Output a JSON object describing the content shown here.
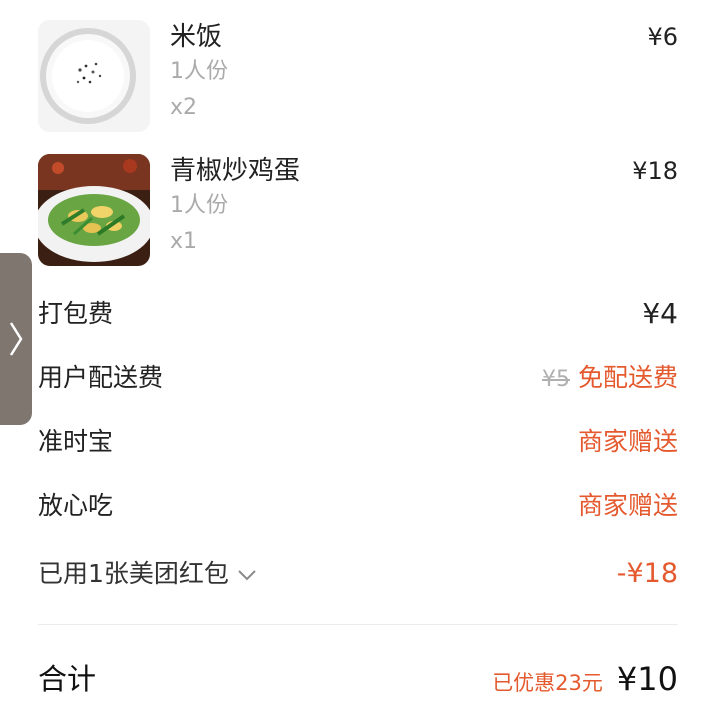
{
  "items": [
    {
      "name": "米饭",
      "spec": "1人份",
      "qty": "x2",
      "price": "¥6",
      "image": "rice-bowl-photo"
    },
    {
      "name": "青椒炒鸡蛋",
      "spec": "1人份",
      "qty": "x1",
      "price": "¥18",
      "image": "green-pepper-egg-photo"
    }
  ],
  "fees": {
    "packing": {
      "label": "打包费",
      "value": "¥4"
    },
    "delivery": {
      "label": "用户配送费",
      "original": "¥5",
      "value": "免配送费"
    },
    "on_time": {
      "label": "准时宝",
      "value": "商家赠送"
    },
    "safe_eat": {
      "label": "放心吃",
      "value": "商家赠送"
    },
    "coupon": {
      "label": "已用1张美团红包",
      "value": "-¥18"
    }
  },
  "total": {
    "label": "合计",
    "discount": "已优惠23元",
    "value": "¥10"
  },
  "colors": {
    "accent": "#e45a2e",
    "muted": "#aaaaaa",
    "side_tab": "#7f7670"
  },
  "icons": {
    "side_tab": "chevron-right-icon",
    "coupon": "chevron-down-icon"
  }
}
